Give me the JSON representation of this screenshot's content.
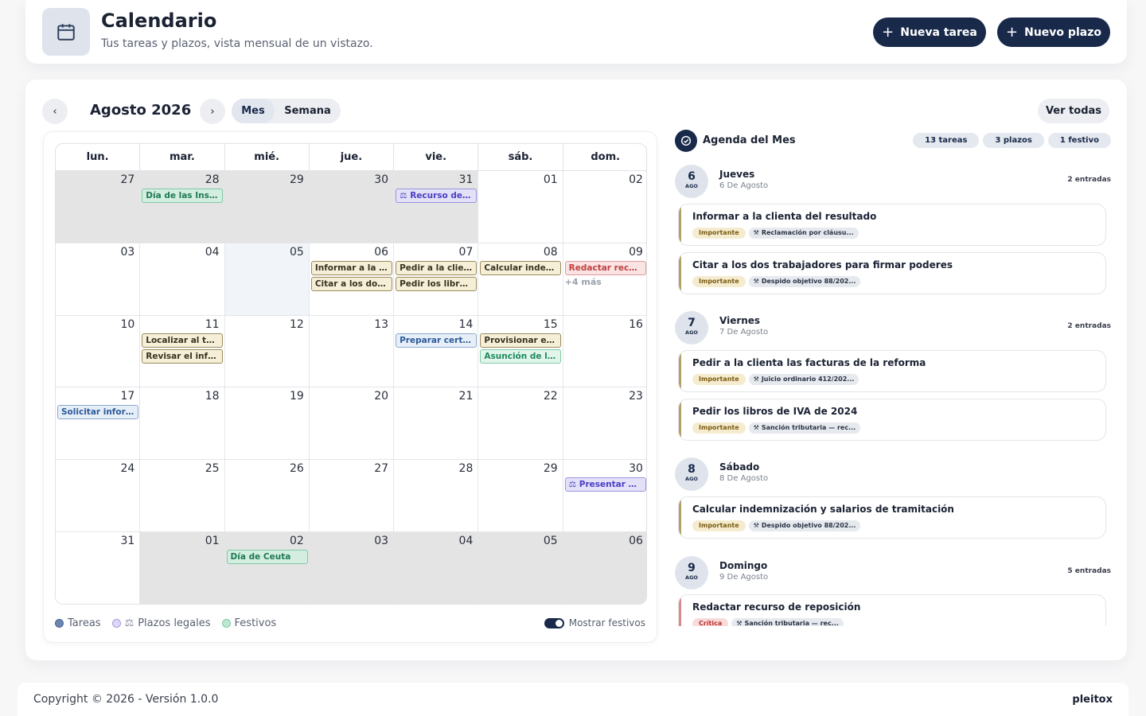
{
  "header": {
    "title": "Calendario",
    "subtitle": "Tus tareas y plazos, vista mensual de un vistazo.",
    "new_task": "Nueva tarea",
    "new_deadline": "Nuevo plazo",
    "icon": "calendar-icon"
  },
  "calendar": {
    "prev": "‹",
    "next": "›",
    "month_label": "Agosto 2026",
    "view_month": "Mes",
    "view_week": "Semana",
    "see_all": "Ver todas",
    "weekdays": [
      "lun.",
      "mar.",
      "mié.",
      "jue.",
      "vie.",
      "sáb.",
      "dom."
    ],
    "weeks": [
      [
        "27",
        "28",
        "29",
        "30",
        "31",
        "01",
        "02"
      ],
      [
        "03",
        "04",
        "05",
        "06",
        "07",
        "08",
        "09"
      ],
      [
        "10",
        "11",
        "12",
        "13",
        "14",
        "15",
        "16"
      ],
      [
        "17",
        "18",
        "19",
        "20",
        "21",
        "22",
        "23"
      ],
      [
        "24",
        "25",
        "26",
        "27",
        "28",
        "29",
        "30"
      ],
      [
        "31",
        "01",
        "02",
        "03",
        "04",
        "05",
        "06"
      ]
    ],
    "events": {
      "w0_tue": "Día de las Institu...",
      "w0_fri": "Recurso de a...",
      "w1_thu_1": "Informar a la clie...",
      "w1_thu_2": "Citar a los dos tr...",
      "w1_fri_1": "Pedir a la clienta...",
      "w1_fri_2": "Pedir los libros d...",
      "w1_sat": "Calcular indemn...",
      "w1_sun": "Redactar recurs...",
      "w1_sun_more": "+4 más",
      "w2_tue_1": "Localizar al testi...",
      "w2_tue_2": "Revisar el inform...",
      "w2_fri": "Preparar certific...",
      "w2_sat_1": "Provisionar el pa...",
      "w2_sat_2": "Asunción de la V...",
      "w3_mon": "Solicitar informe ...",
      "w4_sun": "Presentar el p...",
      "w5_wed": "Día de Ceuta"
    },
    "legend": {
      "tasks": "Tareas",
      "deadlines": "Plazos legales",
      "holidays": "Festivos",
      "show_holidays": "Mostrar festivos"
    }
  },
  "agenda": {
    "title": "Agenda del Mes",
    "pills": [
      "13 tareas",
      "3 plazos",
      "1 festivo"
    ],
    "days": [
      {
        "num": "6",
        "mon": "AGO",
        "name": "Jueves",
        "date": "6 De Agosto",
        "count": "2 entradas",
        "events": [
          {
            "title": "Informar a la clienta del resultado",
            "priority": "Importante",
            "case": "Reclamación por cláusu..."
          },
          {
            "title": "Citar a los dos trabajadores para firmar poderes",
            "priority": "Importante",
            "case": "Despido objetivo 88/202..."
          }
        ]
      },
      {
        "num": "7",
        "mon": "AGO",
        "name": "Viernes",
        "date": "7 De Agosto",
        "count": "2 entradas",
        "events": [
          {
            "title": "Pedir a la clienta las facturas de la reforma",
            "priority": "Importante",
            "case": "Juicio ordinario 412/202..."
          },
          {
            "title": "Pedir los libros de IVA de 2024",
            "priority": "Importante",
            "case": "Sanción tributaria — rec..."
          }
        ]
      },
      {
        "num": "8",
        "mon": "AGO",
        "name": "Sábado",
        "date": "8 De Agosto",
        "count": "",
        "events": [
          {
            "title": "Calcular indemnización y salarios de tramitación",
            "priority": "Importante",
            "case": "Despido objetivo 88/202..."
          }
        ]
      },
      {
        "num": "9",
        "mon": "AGO",
        "name": "Domingo",
        "date": "9 De Agosto",
        "count": "5 entradas",
        "events": [
          {
            "title": "Redactar recurso de reposición",
            "priority": "Crítica",
            "case": "Sanción tributaria — rec..."
          }
        ]
      }
    ]
  },
  "footer": {
    "copyright": "Copyright © 2026 - Versión 1.0.0",
    "brand": "pleitox"
  },
  "colors": {
    "primary": "#18294a",
    "task": "#f6efd8",
    "holiday": "#d3eee0",
    "deadline": "#e3e1f7"
  }
}
